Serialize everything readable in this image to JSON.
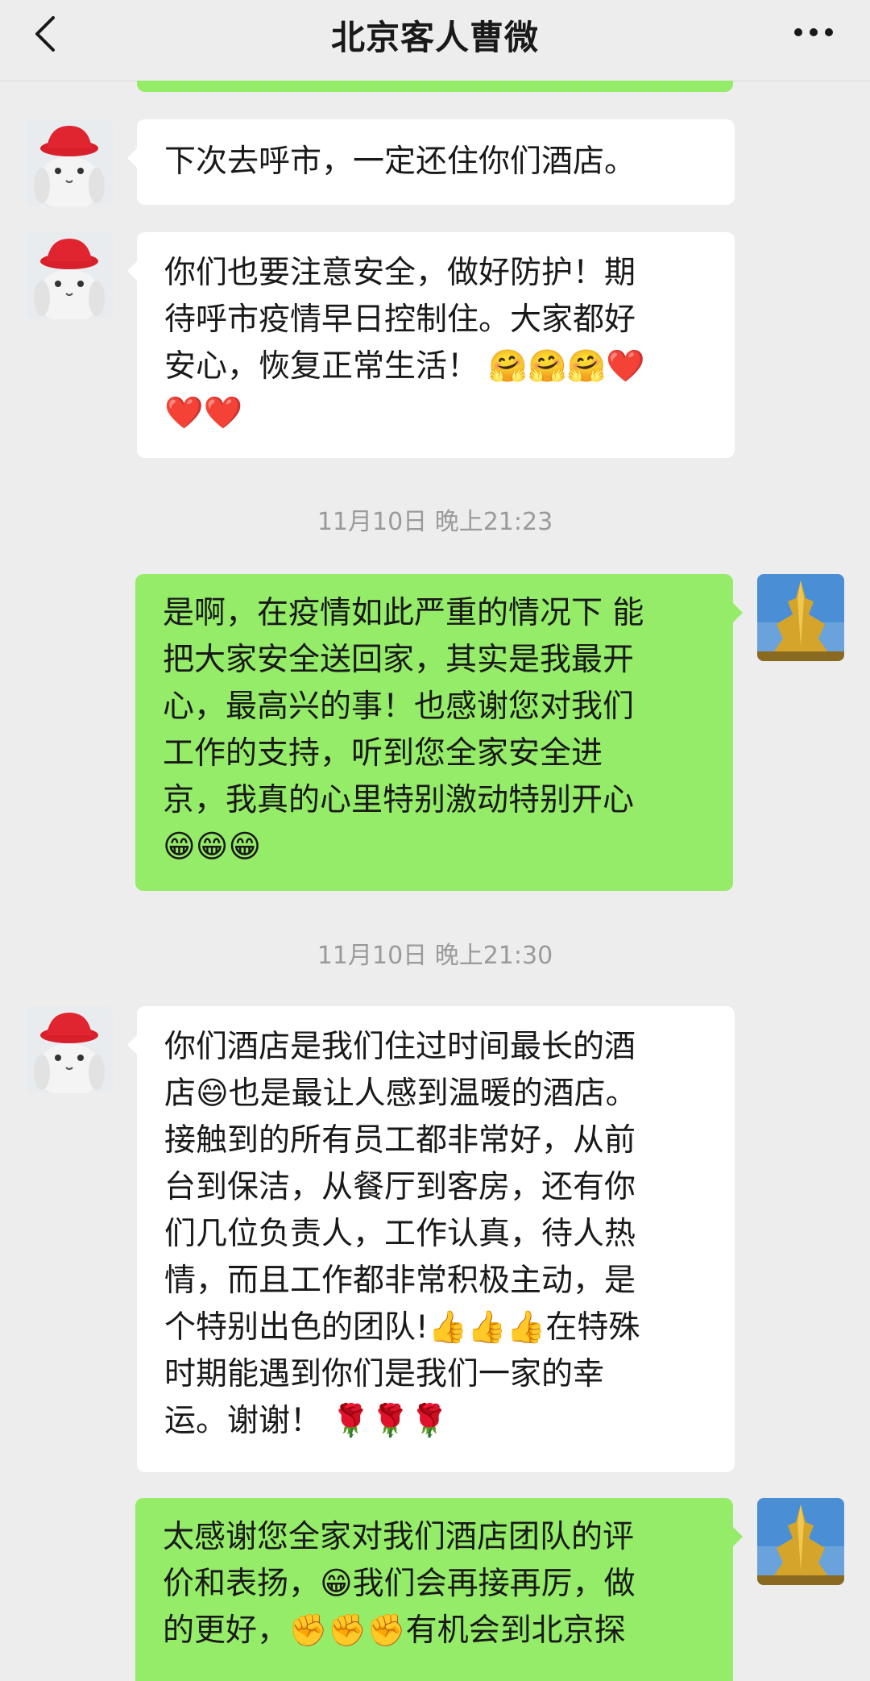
{
  "header": {
    "title": "北京客人曹微",
    "back_icon": "chevron-left-icon",
    "more_icon": "more-dots-icon"
  },
  "messages": [
    {
      "side": "left",
      "text": "下次去呼市，一定还住你们酒店。"
    },
    {
      "side": "left",
      "text": "你们也要注意安全，做好防护！期\n待呼市疫情早日控制住。大家都好\n安心，恢复正常生活！ 🤗🤗🤗❤️\n❤️❤️"
    },
    {
      "side": "right",
      "text": "是啊，在疫情如此严重的情况下 能\n把大家安全送回家，其实是我最开\n心，最高兴的事！也感谢您对我们\n工作的支持，听到您全家安全进\n京，我真的心里特别激动特别开心\n😁😁😁"
    },
    {
      "side": "left",
      "text": "你们酒店是我们住过时间最长的酒\n店😄也是最让人感到温暖的酒店。\n接触到的所有员工都非常好，从前\n台到保洁，从餐厅到客房，还有你\n们几位负责人，工作认真，待人热\n情，而且工作都非常积极主动，是\n个特别出色的团队!👍👍👍在特殊\n时期能遇到你们是我们一家的幸\n运。谢谢！ 🌹🌹🌹"
    },
    {
      "side": "right",
      "text": "太感谢您全家对我们酒店团队的评\n价和表扬，😁我们会再接再厉，做\n的更好，✊✊✊有机会到北京探"
    }
  ],
  "timestamps": [
    "11月10日 晚上21:23",
    "11月10日 晚上21:30"
  ],
  "colors": {
    "background": "#ededed",
    "bubble_self": "#95ec69",
    "bubble_other": "#ffffff",
    "timestamp": "#9a9a9a"
  }
}
